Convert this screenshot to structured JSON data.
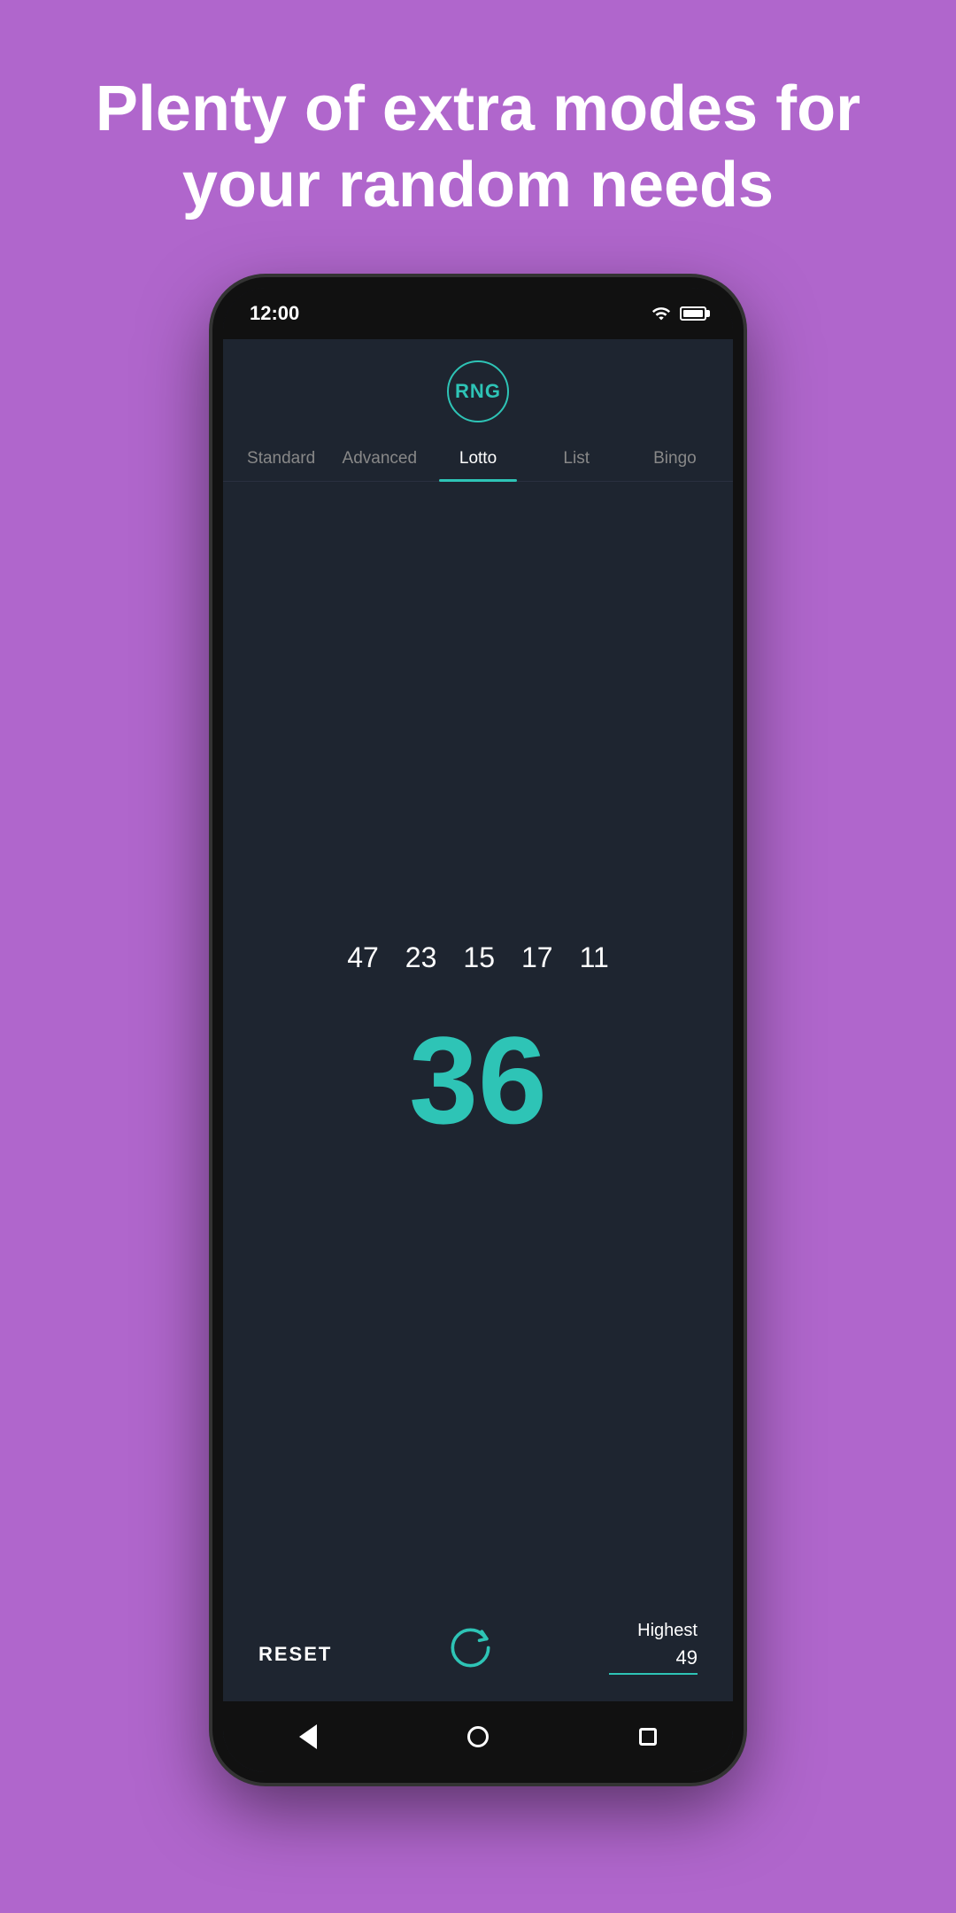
{
  "hero": {
    "title": "Plenty of extra modes for your random needs"
  },
  "status_bar": {
    "time": "12:00"
  },
  "app": {
    "logo_text": "RNG",
    "tabs": [
      {
        "id": "standard",
        "label": "Standard",
        "active": false
      },
      {
        "id": "advanced",
        "label": "Advanced",
        "active": false
      },
      {
        "id": "lotto",
        "label": "Lotto",
        "active": true
      },
      {
        "id": "list",
        "label": "List",
        "active": false
      },
      {
        "id": "bingo",
        "label": "Bingo",
        "active": false
      }
    ],
    "history_numbers": [
      "47",
      "23",
      "15",
      "17",
      "11"
    ],
    "current_number": "36",
    "reset_label": "RESET",
    "highest_label": "Highest",
    "highest_value": "49"
  },
  "colors": {
    "accent": "#2ec4b6",
    "background_dark": "#1e2530",
    "text_primary": "#ffffff",
    "purple_bg": "#b066cc"
  }
}
